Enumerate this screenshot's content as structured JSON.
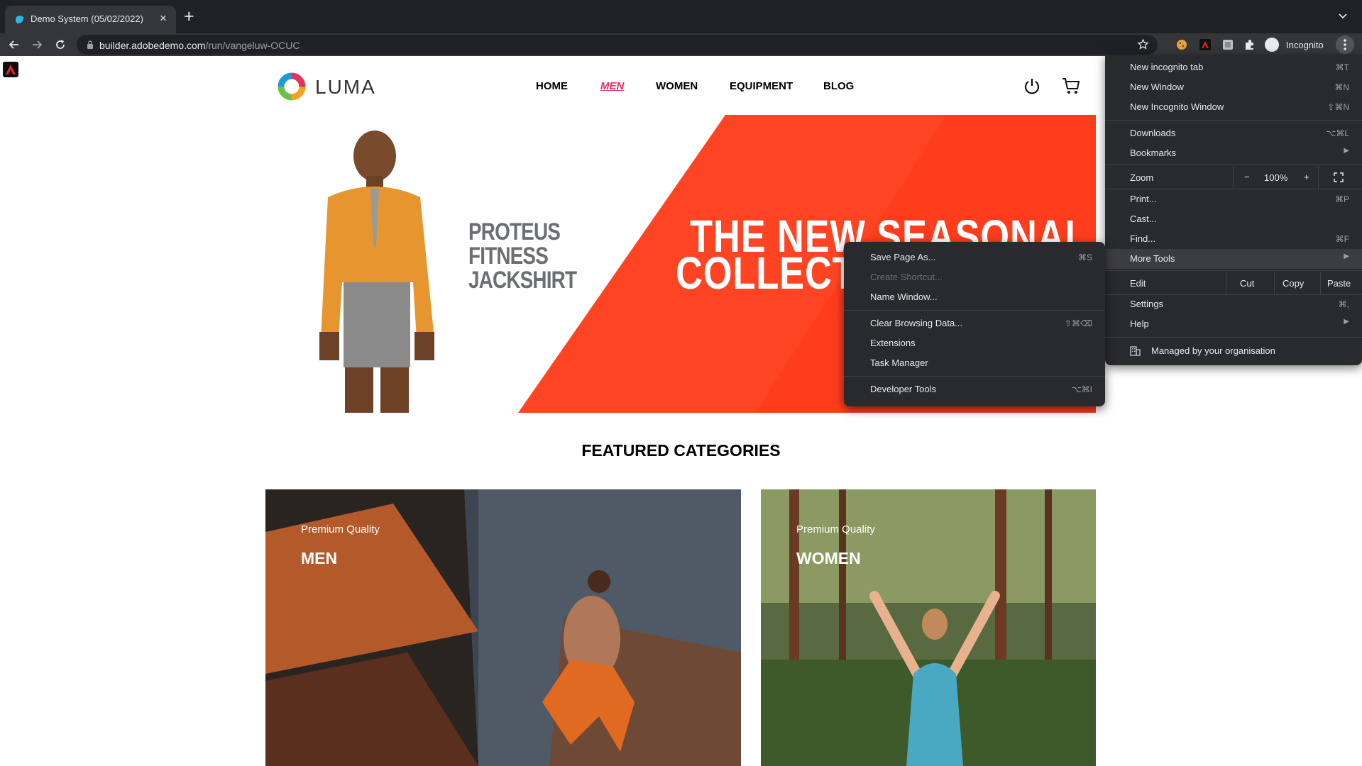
{
  "browser": {
    "tab_title": "Demo System (05/02/2022)",
    "tab_close": "×",
    "new_tab": "+",
    "url_domain": "builder.adobedemo.com",
    "url_path": "/run/vangeluw-OCUC",
    "profile_label": "Incognito"
  },
  "site": {
    "logo_text": "LUMA",
    "nav": [
      "HOME",
      "MEN",
      "WOMEN",
      "EQUIPMENT",
      "BLOG"
    ],
    "active_nav": "MEN",
    "brand_color": "#e22f62"
  },
  "hero": {
    "product_lines": [
      "PROTEUS",
      "FITNESS",
      "JACKSHIRT"
    ],
    "headline_lines": [
      "THE NEW SEASONAL",
      "COLLECTION"
    ],
    "accent_color": "#ff4423"
  },
  "featured": {
    "title": "FEATURED CATEGORIES",
    "categories": [
      {
        "subtitle": "Premium Quality",
        "title": "MEN"
      },
      {
        "subtitle": "Premium Quality",
        "title": "WOMEN"
      }
    ]
  },
  "chrome_menu": {
    "new_incognito_tab": {
      "label": "New incognito tab",
      "shortcut": "⌘T"
    },
    "new_window": {
      "label": "New Window",
      "shortcut": "⌘N"
    },
    "new_incognito_window": {
      "label": "New Incognito Window",
      "shortcut": "⇧⌘N"
    },
    "downloads": {
      "label": "Downloads",
      "shortcut": "⌥⌘L"
    },
    "bookmarks": {
      "label": "Bookmarks"
    },
    "zoom": {
      "label": "Zoom",
      "minus": "−",
      "value": "100%",
      "plus": "+"
    },
    "print": {
      "label": "Print...",
      "shortcut": "⌘P"
    },
    "cast": {
      "label": "Cast..."
    },
    "find": {
      "label": "Find...",
      "shortcut": "⌘F"
    },
    "more_tools": {
      "label": "More Tools"
    },
    "edit": {
      "label": "Edit",
      "cut": "Cut",
      "copy": "Copy",
      "paste": "Paste"
    },
    "settings": {
      "label": "Settings",
      "shortcut": "⌘,"
    },
    "help": {
      "label": "Help"
    },
    "managed": {
      "label": "Managed by your organisation"
    }
  },
  "more_tools_menu": [
    {
      "label": "Save Page As...",
      "shortcut": "⌘S",
      "disabled": false
    },
    {
      "label": "Create Shortcut...",
      "shortcut": "",
      "disabled": true
    },
    {
      "label": "Name Window...",
      "shortcut": "",
      "disabled": false
    },
    {
      "label": "Clear Browsing Data...",
      "shortcut": "⇧⌘⌫",
      "disabled": false
    },
    {
      "label": "Extensions",
      "shortcut": "",
      "disabled": false
    },
    {
      "label": "Task Manager",
      "shortcut": "",
      "disabled": false
    },
    {
      "label": "Developer Tools",
      "shortcut": "⌥⌘I",
      "disabled": false
    }
  ]
}
